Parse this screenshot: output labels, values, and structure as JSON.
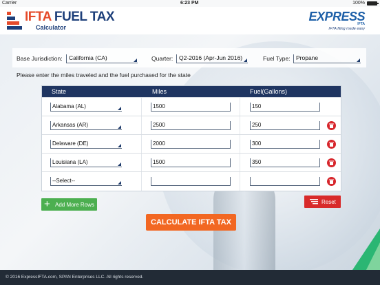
{
  "status_bar": {
    "carrier": "Carrier",
    "time": "6:23 PM",
    "battery": "100%"
  },
  "header": {
    "brand_ifta": "IFTA",
    "brand_rest": " FUEL TAX",
    "subtitle": "Calculator",
    "express_logo": "EXPRESS",
    "express_sub": "IFTA",
    "express_tagline": "IFTA filing made easy"
  },
  "filters": {
    "jurisdiction_label": "Base Jurisdiction:",
    "jurisdiction_value": "California (CA)",
    "quarter_label": "Quarter:",
    "quarter_value": "Q2-2016 (Apr-Jun 2016)",
    "fuel_label": "Fuel Type:",
    "fuel_value": "Propane"
  },
  "instruction": "Please enter the miles traveled and the fuel purchased for the state",
  "table": {
    "headers": {
      "state": "State",
      "miles": "Miles",
      "fuel": "Fuel(Gallons)"
    },
    "rows": [
      {
        "state": "Alabama (AL)",
        "miles": "1500",
        "fuel": "150",
        "deletable": false
      },
      {
        "state": "Arkansas (AR)",
        "miles": "2500",
        "fuel": "250",
        "deletable": true
      },
      {
        "state": "Delaware (DE)",
        "miles": "2000",
        "fuel": "300",
        "deletable": true
      },
      {
        "state": "Louisiana (LA)",
        "miles": "1500",
        "fuel": "350",
        "deletable": true
      },
      {
        "state": "--Select--",
        "miles": "",
        "fuel": "",
        "deletable": true
      }
    ]
  },
  "buttons": {
    "add_rows": "Add More Rows",
    "reset": "Reset",
    "calculate": "CALCULATE IFTA TAX"
  },
  "footer": "© 2016 ExpressIFTA.com, SPAN Enterprises LLC. All rights reserved.",
  "colors": {
    "header_navy": "#1f3561",
    "accent_orange": "#f26722",
    "add_green": "#4caf50",
    "reset_red": "#d82a2a",
    "brand_red": "#e54b2b"
  }
}
